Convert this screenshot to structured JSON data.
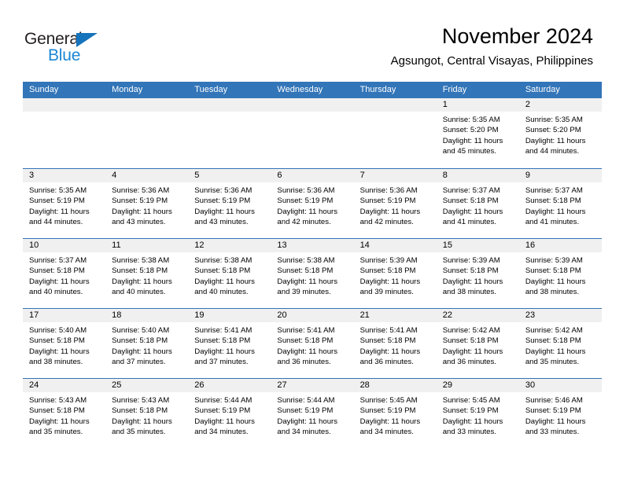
{
  "brand": {
    "word1": "General",
    "word2": "Blue",
    "color_dark": "#231f20",
    "color_blue": "#1b87d4"
  },
  "header": {
    "month_title": "November 2024",
    "location": "Agsungot, Central Visayas, Philippines"
  },
  "theme": {
    "header_blue": "#3275b8",
    "daynum_gray": "#f0f0f0",
    "text": "#000000"
  },
  "weekdays": [
    "Sunday",
    "Monday",
    "Tuesday",
    "Wednesday",
    "Thursday",
    "Friday",
    "Saturday"
  ],
  "weeks": [
    [
      {
        "day": ""
      },
      {
        "day": ""
      },
      {
        "day": ""
      },
      {
        "day": ""
      },
      {
        "day": ""
      },
      {
        "day": "1",
        "sunrise": "Sunrise: 5:35 AM",
        "sunset": "Sunset: 5:20 PM",
        "daylight": "Daylight: 11 hours and 45 minutes."
      },
      {
        "day": "2",
        "sunrise": "Sunrise: 5:35 AM",
        "sunset": "Sunset: 5:20 PM",
        "daylight": "Daylight: 11 hours and 44 minutes."
      }
    ],
    [
      {
        "day": "3",
        "sunrise": "Sunrise: 5:35 AM",
        "sunset": "Sunset: 5:19 PM",
        "daylight": "Daylight: 11 hours and 44 minutes."
      },
      {
        "day": "4",
        "sunrise": "Sunrise: 5:36 AM",
        "sunset": "Sunset: 5:19 PM",
        "daylight": "Daylight: 11 hours and 43 minutes."
      },
      {
        "day": "5",
        "sunrise": "Sunrise: 5:36 AM",
        "sunset": "Sunset: 5:19 PM",
        "daylight": "Daylight: 11 hours and 43 minutes."
      },
      {
        "day": "6",
        "sunrise": "Sunrise: 5:36 AM",
        "sunset": "Sunset: 5:19 PM",
        "daylight": "Daylight: 11 hours and 42 minutes."
      },
      {
        "day": "7",
        "sunrise": "Sunrise: 5:36 AM",
        "sunset": "Sunset: 5:19 PM",
        "daylight": "Daylight: 11 hours and 42 minutes."
      },
      {
        "day": "8",
        "sunrise": "Sunrise: 5:37 AM",
        "sunset": "Sunset: 5:18 PM",
        "daylight": "Daylight: 11 hours and 41 minutes."
      },
      {
        "day": "9",
        "sunrise": "Sunrise: 5:37 AM",
        "sunset": "Sunset: 5:18 PM",
        "daylight": "Daylight: 11 hours and 41 minutes."
      }
    ],
    [
      {
        "day": "10",
        "sunrise": "Sunrise: 5:37 AM",
        "sunset": "Sunset: 5:18 PM",
        "daylight": "Daylight: 11 hours and 40 minutes."
      },
      {
        "day": "11",
        "sunrise": "Sunrise: 5:38 AM",
        "sunset": "Sunset: 5:18 PM",
        "daylight": "Daylight: 11 hours and 40 minutes."
      },
      {
        "day": "12",
        "sunrise": "Sunrise: 5:38 AM",
        "sunset": "Sunset: 5:18 PM",
        "daylight": "Daylight: 11 hours and 40 minutes."
      },
      {
        "day": "13",
        "sunrise": "Sunrise: 5:38 AM",
        "sunset": "Sunset: 5:18 PM",
        "daylight": "Daylight: 11 hours and 39 minutes."
      },
      {
        "day": "14",
        "sunrise": "Sunrise: 5:39 AM",
        "sunset": "Sunset: 5:18 PM",
        "daylight": "Daylight: 11 hours and 39 minutes."
      },
      {
        "day": "15",
        "sunrise": "Sunrise: 5:39 AM",
        "sunset": "Sunset: 5:18 PM",
        "daylight": "Daylight: 11 hours and 38 minutes."
      },
      {
        "day": "16",
        "sunrise": "Sunrise: 5:39 AM",
        "sunset": "Sunset: 5:18 PM",
        "daylight": "Daylight: 11 hours and 38 minutes."
      }
    ],
    [
      {
        "day": "17",
        "sunrise": "Sunrise: 5:40 AM",
        "sunset": "Sunset: 5:18 PM",
        "daylight": "Daylight: 11 hours and 38 minutes."
      },
      {
        "day": "18",
        "sunrise": "Sunrise: 5:40 AM",
        "sunset": "Sunset: 5:18 PM",
        "daylight": "Daylight: 11 hours and 37 minutes."
      },
      {
        "day": "19",
        "sunrise": "Sunrise: 5:41 AM",
        "sunset": "Sunset: 5:18 PM",
        "daylight": "Daylight: 11 hours and 37 minutes."
      },
      {
        "day": "20",
        "sunrise": "Sunrise: 5:41 AM",
        "sunset": "Sunset: 5:18 PM",
        "daylight": "Daylight: 11 hours and 36 minutes."
      },
      {
        "day": "21",
        "sunrise": "Sunrise: 5:41 AM",
        "sunset": "Sunset: 5:18 PM",
        "daylight": "Daylight: 11 hours and 36 minutes."
      },
      {
        "day": "22",
        "sunrise": "Sunrise: 5:42 AM",
        "sunset": "Sunset: 5:18 PM",
        "daylight": "Daylight: 11 hours and 36 minutes."
      },
      {
        "day": "23",
        "sunrise": "Sunrise: 5:42 AM",
        "sunset": "Sunset: 5:18 PM",
        "daylight": "Daylight: 11 hours and 35 minutes."
      }
    ],
    [
      {
        "day": "24",
        "sunrise": "Sunrise: 5:43 AM",
        "sunset": "Sunset: 5:18 PM",
        "daylight": "Daylight: 11 hours and 35 minutes."
      },
      {
        "day": "25",
        "sunrise": "Sunrise: 5:43 AM",
        "sunset": "Sunset: 5:18 PM",
        "daylight": "Daylight: 11 hours and 35 minutes."
      },
      {
        "day": "26",
        "sunrise": "Sunrise: 5:44 AM",
        "sunset": "Sunset: 5:19 PM",
        "daylight": "Daylight: 11 hours and 34 minutes."
      },
      {
        "day": "27",
        "sunrise": "Sunrise: 5:44 AM",
        "sunset": "Sunset: 5:19 PM",
        "daylight": "Daylight: 11 hours and 34 minutes."
      },
      {
        "day": "28",
        "sunrise": "Sunrise: 5:45 AM",
        "sunset": "Sunset: 5:19 PM",
        "daylight": "Daylight: 11 hours and 34 minutes."
      },
      {
        "day": "29",
        "sunrise": "Sunrise: 5:45 AM",
        "sunset": "Sunset: 5:19 PM",
        "daylight": "Daylight: 11 hours and 33 minutes."
      },
      {
        "day": "30",
        "sunrise": "Sunrise: 5:46 AM",
        "sunset": "Sunset: 5:19 PM",
        "daylight": "Daylight: 11 hours and 33 minutes."
      }
    ]
  ]
}
